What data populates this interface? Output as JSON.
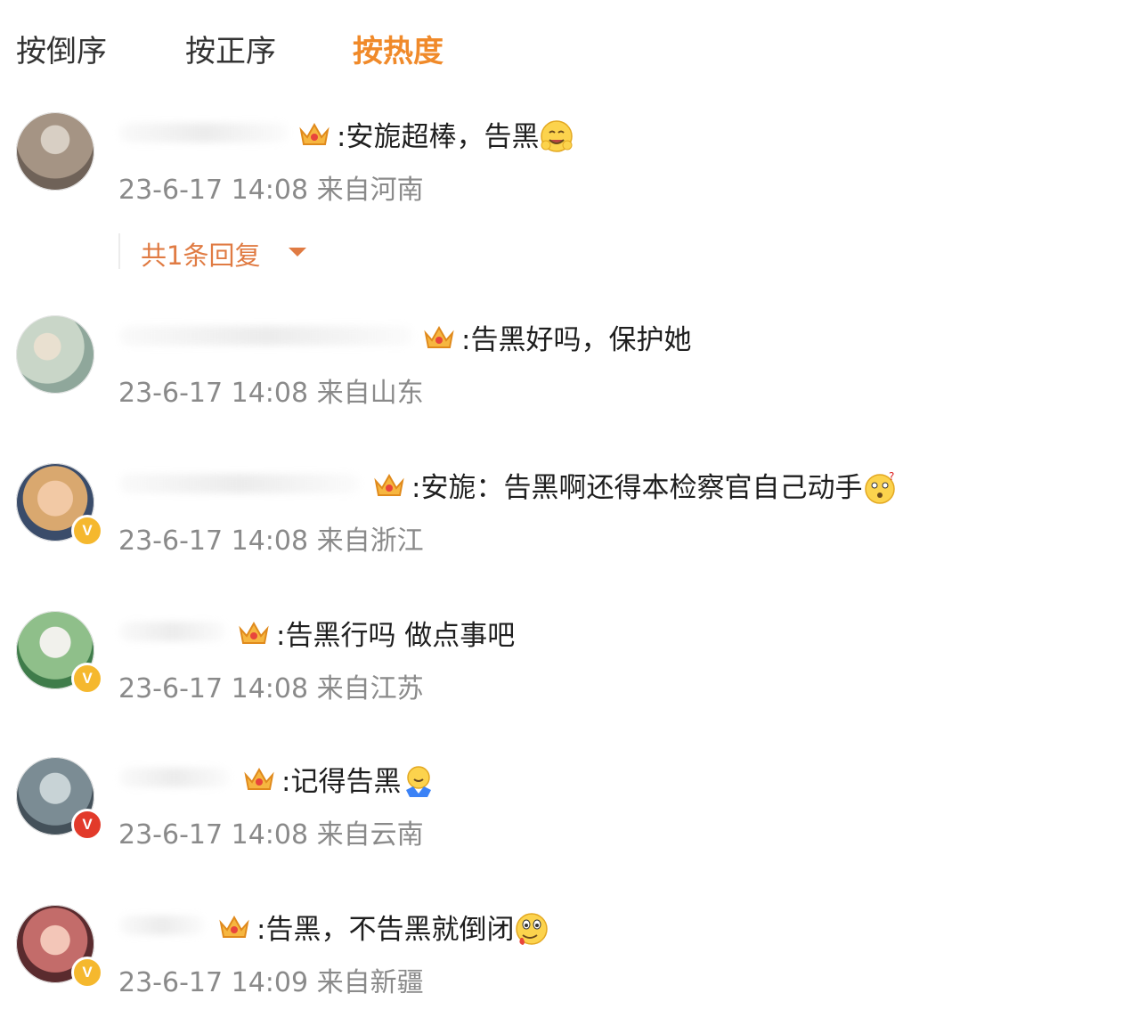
{
  "sort_tabs": [
    {
      "label": "按倒序",
      "active": false
    },
    {
      "label": "按正序",
      "active": false
    },
    {
      "label": "按热度",
      "active": true
    }
  ],
  "accent_color": "#f08a2a",
  "comments": [
    {
      "text": ":安旎超棒，告黑",
      "emoji": "hugging-face-emoji",
      "meta": "23-6-17 14:08 来自河南",
      "badge": null,
      "reply_label": "共1条回复"
    },
    {
      "text": ":告黑好吗，保护她",
      "emoji": null,
      "meta": "23-6-17 14:08 来自山东",
      "badge": null
    },
    {
      "text": ":安旎：告黑啊还得本检察官自己动手",
      "emoji": "confused-face-emoji",
      "meta": "23-6-17 14:08 来自浙江",
      "badge": "V"
    },
    {
      "text": ":告黑行吗 做点事吧",
      "emoji": null,
      "meta": "23-6-17 14:08 来自江苏",
      "badge": "V"
    },
    {
      "text": ":记得告黑",
      "emoji": "shrug-emoji",
      "meta": "23-6-17 14:08 来自云南",
      "badge": "V"
    },
    {
      "text": ":告黑，不告黑就倒闭",
      "emoji": "drooling-face-emoji",
      "meta": "23-6-17 14:09 来自新疆",
      "badge": "V"
    }
  ]
}
